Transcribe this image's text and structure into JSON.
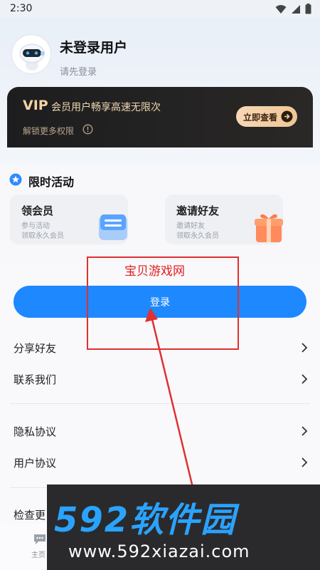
{
  "status_bar": {
    "time": "2:30"
  },
  "profile": {
    "name": "未登录用户",
    "subtitle": "请先登录"
  },
  "vip": {
    "tag": "VIP",
    "title": "会员用户畅享高速无限次",
    "subtitle": "解锁更多权限",
    "button_label": "立即查看"
  },
  "activities": {
    "title": "限时活动",
    "cards": [
      {
        "title": "领会员",
        "line1": "参与活动",
        "line2": "领取永久会员"
      },
      {
        "title": "邀请好友",
        "line1": "邀请好友",
        "line2": "领取永久会员"
      }
    ]
  },
  "login_button": "登录",
  "menu": [
    {
      "label": "分享好友"
    },
    {
      "label": "联系我们"
    },
    {
      "label": "隐私协议"
    },
    {
      "label": "用户协议"
    },
    {
      "label": "检查更"
    }
  ],
  "tabbar": {
    "home_label": "主页"
  },
  "annotation": {
    "text": "宝贝游戏网"
  },
  "watermark": {
    "brand": "592软件园",
    "url": "www.592xiazai.com"
  },
  "colors": {
    "primary": "#1e88ff",
    "vip_gold": "#f2d3a4",
    "annotation_red": "#e03030",
    "watermark_blue": "#2aa3ff"
  }
}
